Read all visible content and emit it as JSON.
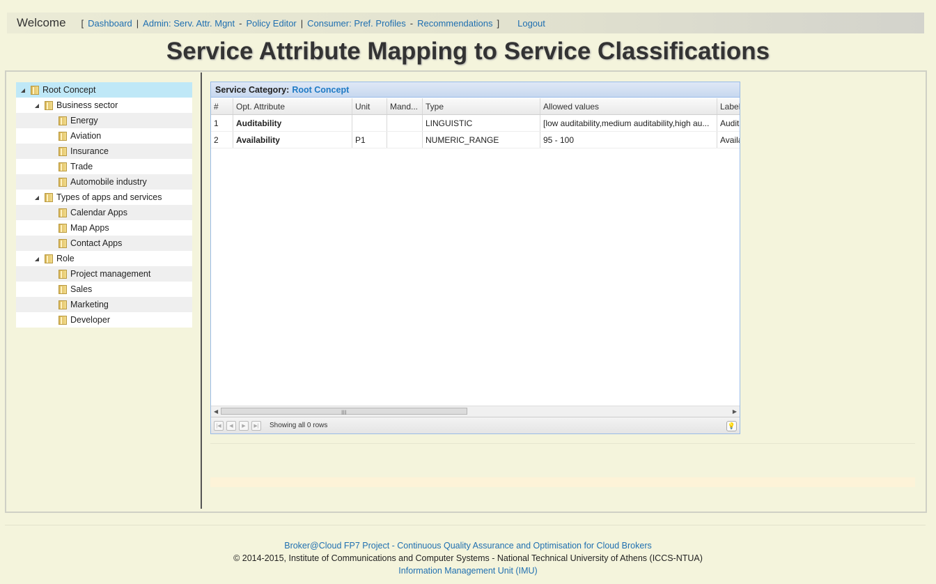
{
  "nav": {
    "welcome": "Welcome",
    "bracket_open": "[",
    "bracket_close": "]",
    "links": [
      {
        "label": "Dashboard"
      },
      {
        "label": "Admin: Serv. Attr. Mgnt"
      },
      {
        "label": "Policy Editor"
      },
      {
        "label": "Consumer: Pref. Profiles"
      },
      {
        "label": "Recommendations"
      }
    ],
    "separators": [
      "|",
      "-",
      "|",
      "-"
    ],
    "logout": "Logout"
  },
  "page_title": "Service Attribute Mapping to Service Classifications",
  "tree": {
    "nodes": [
      {
        "label": "Root Concept",
        "level": 0,
        "expandable": true,
        "selected": true
      },
      {
        "label": "Business sector",
        "level": 1,
        "expandable": true
      },
      {
        "label": "Energy",
        "level": 2
      },
      {
        "label": "Aviation",
        "level": 2
      },
      {
        "label": "Insurance",
        "level": 2
      },
      {
        "label": "Trade",
        "level": 2
      },
      {
        "label": "Automobile industry",
        "level": 2
      },
      {
        "label": "Types of apps and services",
        "level": 1,
        "expandable": true
      },
      {
        "label": "Calendar Apps",
        "level": 2
      },
      {
        "label": "Map Apps",
        "level": 2
      },
      {
        "label": "Contact Apps",
        "level": 2
      },
      {
        "label": "Role",
        "level": 1,
        "expandable": true
      },
      {
        "label": "Project management",
        "level": 2
      },
      {
        "label": "Sales",
        "level": 2
      },
      {
        "label": "Marketing",
        "level": 2
      },
      {
        "label": "Developer",
        "level": 2
      }
    ],
    "expand_glyph": "◢"
  },
  "grid": {
    "caption_label": "Service Category:",
    "caption_value": "Root Concept",
    "columns": [
      "#",
      "Opt. Attribute",
      "Unit",
      "Mand...",
      "Type",
      "Allowed values",
      "Label"
    ],
    "rows": [
      [
        "1",
        "Auditability",
        "",
        "",
        "LINGUISTIC",
        "[low auditability,medium auditability,high au...",
        "Audita"
      ],
      [
        "2",
        "Availability",
        "P1",
        "",
        "NUMERIC_RANGE",
        "95 - 100",
        "Availa"
      ]
    ],
    "pager_text": "Showing all 0 rows",
    "scroll_grip": "III",
    "scroll_left": "◀",
    "scroll_right": "▶",
    "pager_buttons": [
      "|◀",
      "◀",
      "▶",
      "▶|"
    ],
    "bulb_icon": "💡"
  },
  "footer": {
    "project_link": "Broker@Cloud FP7 Project - Continuous Quality Assurance and Optimisation for Cloud Brokers",
    "copyright": "© 2014-2015, Institute of Communications and Computer Systems - National Technical University of Athens (ICCS-NTUA)",
    "unit_link": "Information Management Unit (IMU)"
  }
}
